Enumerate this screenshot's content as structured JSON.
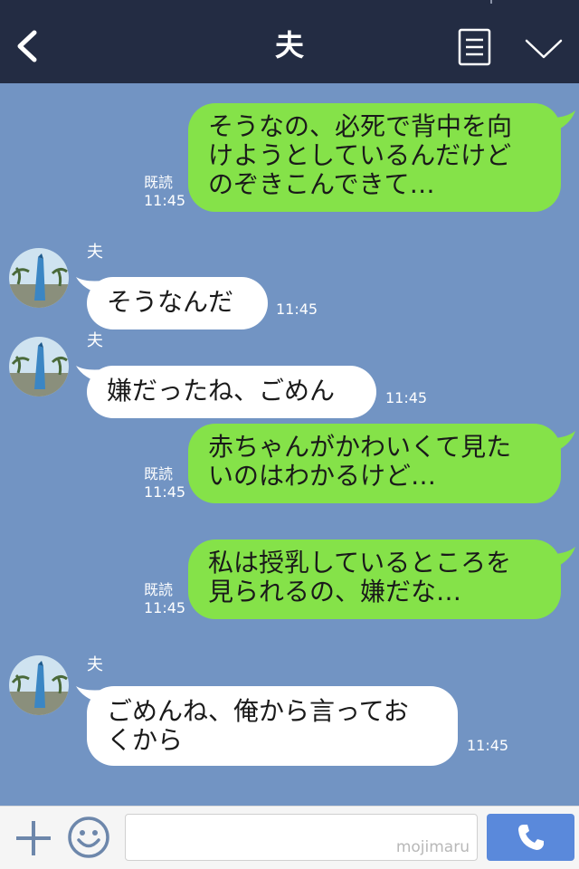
{
  "header": {
    "title": "夫",
    "back_icon": "chevron-left-icon",
    "menu_icon": "list-icon",
    "expand_icon": "chevron-down-icon"
  },
  "messages": [
    {
      "side": "sent",
      "text": "そうなの、必死で背中を向\nけようとしているんだけど\nのぞきこんできて…",
      "read": "既読",
      "time": "11:45"
    },
    {
      "side": "received",
      "sender": "夫",
      "text": "そうなんだ",
      "time": "11:45"
    },
    {
      "side": "received",
      "sender": "夫",
      "text": "嫌だったね、ごめん",
      "time": "11:45"
    },
    {
      "side": "sent",
      "text": "赤ちゃんがかわいくて見た\nいのはわかるけど…",
      "read": "既読",
      "time": "11:45"
    },
    {
      "side": "sent",
      "text": "私は授乳しているところを\n見られるの、嫌だな…",
      "read": "既読",
      "time": "11:45"
    },
    {
      "side": "received",
      "sender": "夫",
      "text": "ごめんね、俺から言ってお\nくから",
      "time": "11:45"
    }
  ],
  "footer": {
    "plus_icon": "plus-icon",
    "emoji_icon": "smiley-icon",
    "input_value": "",
    "watermark": "mojimaru",
    "call_icon": "phone-icon"
  },
  "colors": {
    "background": "#7294c3",
    "header": "#232c43",
    "sent_bubble": "#85e249",
    "received_bubble": "#ffffff",
    "call_button": "#5a89db"
  }
}
